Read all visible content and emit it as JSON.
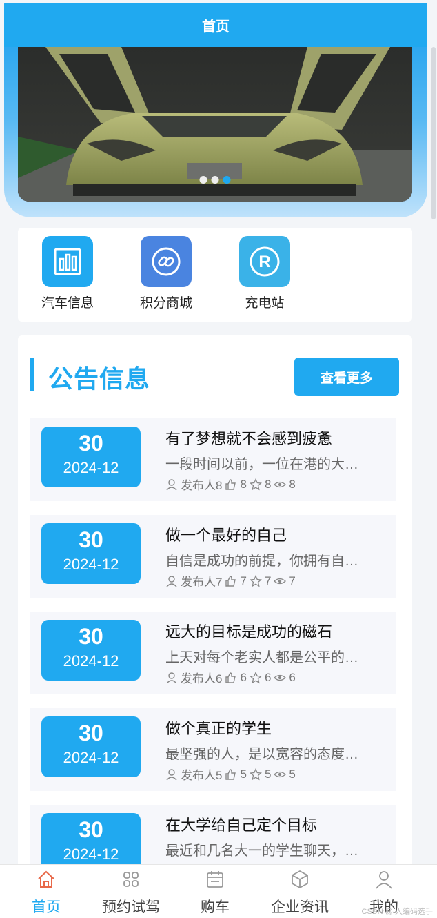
{
  "header": {
    "title": "首页"
  },
  "banner": {
    "slide_count": 3,
    "active_index": 2
  },
  "quick_links": [
    {
      "label": "汽车信息",
      "icon": "bar-chart-icon",
      "color": "#20a9f0"
    },
    {
      "label": "积分商城",
      "icon": "link-icon",
      "color": "#4a84e0"
    },
    {
      "label": "充电站",
      "icon": "registered-icon",
      "color": "#3ab2e8"
    }
  ],
  "notice": {
    "title": "公告信息",
    "more_label": "查看更多",
    "items": [
      {
        "day": "30",
        "ym": "2024-12",
        "title": "有了梦想就不会感到疲惫",
        "summary": "一段时间以前，一位在港的大…",
        "author": "发布人8",
        "likes": "8",
        "favorites": "8",
        "views": "8"
      },
      {
        "day": "30",
        "ym": "2024-12",
        "title": "做一个最好的自己",
        "summary": "自信是成功的前提，你拥有自…",
        "author": "发布人7",
        "likes": "7",
        "favorites": "7",
        "views": "7"
      },
      {
        "day": "30",
        "ym": "2024-12",
        "title": "远大的目标是成功的磁石",
        "summary": "上天对每个老实人都是公平的…",
        "author": "发布人6",
        "likes": "6",
        "favorites": "6",
        "views": "6"
      },
      {
        "day": "30",
        "ym": "2024-12",
        "title": "做个真正的学生",
        "summary": "最坚强的人，是以宽容的态度…",
        "author": "发布人5",
        "likes": "5",
        "favorites": "5",
        "views": "5"
      },
      {
        "day": "30",
        "ym": "2024-12",
        "title": "在大学给自己定个目标",
        "summary": "最近和几名大一的学生聊天，…",
        "author": "",
        "likes": "",
        "favorites": "",
        "views": ""
      }
    ]
  },
  "tabbar": [
    {
      "label": "首页",
      "icon": "home-icon",
      "active": true
    },
    {
      "label": "预约试驾",
      "icon": "grid-icon",
      "active": false
    },
    {
      "label": "购车",
      "icon": "calendar-icon",
      "active": false
    },
    {
      "label": "企业资讯",
      "icon": "cube-icon",
      "active": false
    },
    {
      "label": "我的",
      "icon": "user-icon",
      "active": false
    }
  ],
  "watermark": "CSDN @ 人编码选手",
  "colors": {
    "primary": "#20a9f0",
    "background": "#f3f5f8"
  }
}
